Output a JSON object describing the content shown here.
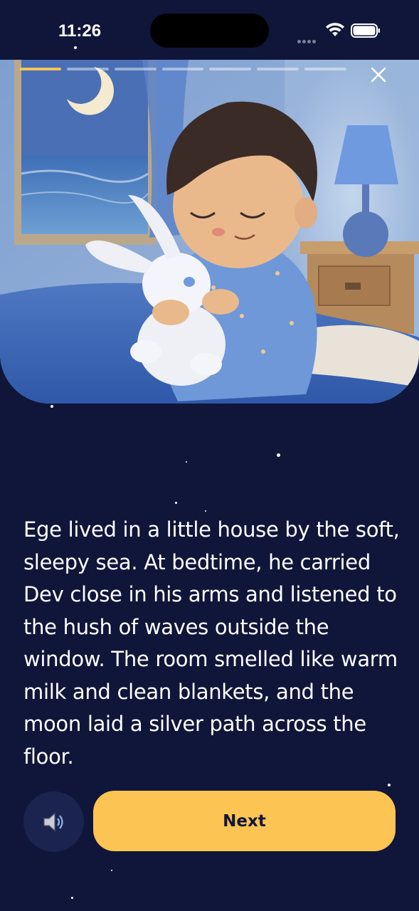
{
  "status_bar": {
    "time": "11:26"
  },
  "story": {
    "progress": {
      "current_page": 1,
      "total_pages": 7
    },
    "text": "Ege lived in a little house by the soft, sleepy sea. At bedtime, he carried Dev close in his arms and listened to the hush of waves outside the window. The room smelled like warm milk and clean blankets, and the moon laid a silver path across the floor."
  },
  "controls": {
    "next_label": "Next",
    "audio_icon": "speaker-icon",
    "close_icon": "close-icon"
  },
  "colors": {
    "background": "#10163a",
    "accent": "#fbc453",
    "progress_active": "#f6c453"
  }
}
